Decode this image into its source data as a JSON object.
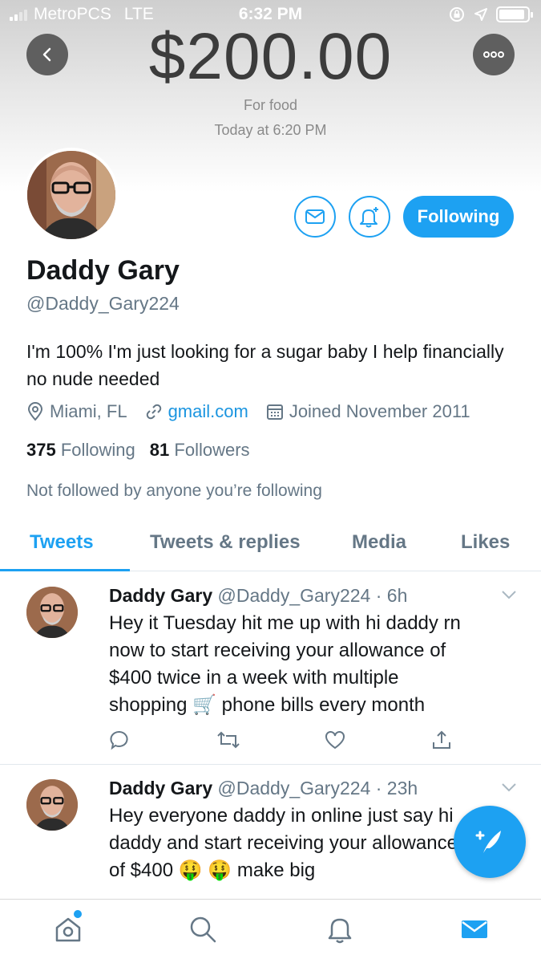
{
  "status_bar": {
    "carrier": "MetroPCS",
    "network": "LTE",
    "time": "6:32 PM",
    "battery_level": 0.9
  },
  "payment": {
    "amount": "$200.00",
    "note": "For food",
    "time": "Today at 6:20 PM"
  },
  "profile": {
    "follow_label": "Following",
    "display_name": "Daddy Gary",
    "handle": "@Daddy_Gary224",
    "bio": "I'm 100% I'm just looking for a sugar baby I help financially no nude needed",
    "location": "Miami, FL",
    "website": "gmail.com",
    "joined": "Joined November 2011",
    "following_count": "375",
    "following_label": "Following",
    "followers_count": "81",
    "followers_label": "Followers",
    "not_followed_text": "Not followed by anyone you’re following"
  },
  "tabs": [
    {
      "label": "Tweets",
      "active": true
    },
    {
      "label": "Tweets & replies",
      "active": false
    },
    {
      "label": "Media",
      "active": false
    },
    {
      "label": "Likes",
      "active": false
    }
  ],
  "tweets": [
    {
      "name": "Daddy Gary",
      "handle_time": "@Daddy_Gary224 · 6h",
      "line1": "Hey it Tuesday hit me up with hi daddy rn",
      "line2": "now to start receiving your allowance of",
      "line3": "$400 twice in a week with multiple",
      "line4a": "shopping",
      "emoji1": "🛒",
      "line4b": "phone bills every month"
    },
    {
      "name": "Daddy Gary",
      "handle_time": "@Daddy_Gary224 · 23h",
      "line1": "Hey everyone daddy in online just say hi",
      "line2": "daddy and start receiving your allowance",
      "line3a": "of $400",
      "emoji1": "🤑",
      "emoji2": "🤑",
      "line3b": "make big"
    }
  ],
  "colors": {
    "accent": "#1da1f2",
    "secondary_text": "#657786"
  },
  "icons": {
    "back": "chevron-left-icon",
    "more": "more-dots-icon",
    "message": "envelope-icon",
    "notify": "bell-plus-icon",
    "location": "location-pin-icon",
    "link": "link-icon",
    "calendar": "calendar-icon",
    "compose": "compose-tweet-icon",
    "tab_home": "home-icon",
    "tab_search": "search-icon",
    "tab_notifications": "bell-icon",
    "tab_messages": "mail-icon"
  }
}
